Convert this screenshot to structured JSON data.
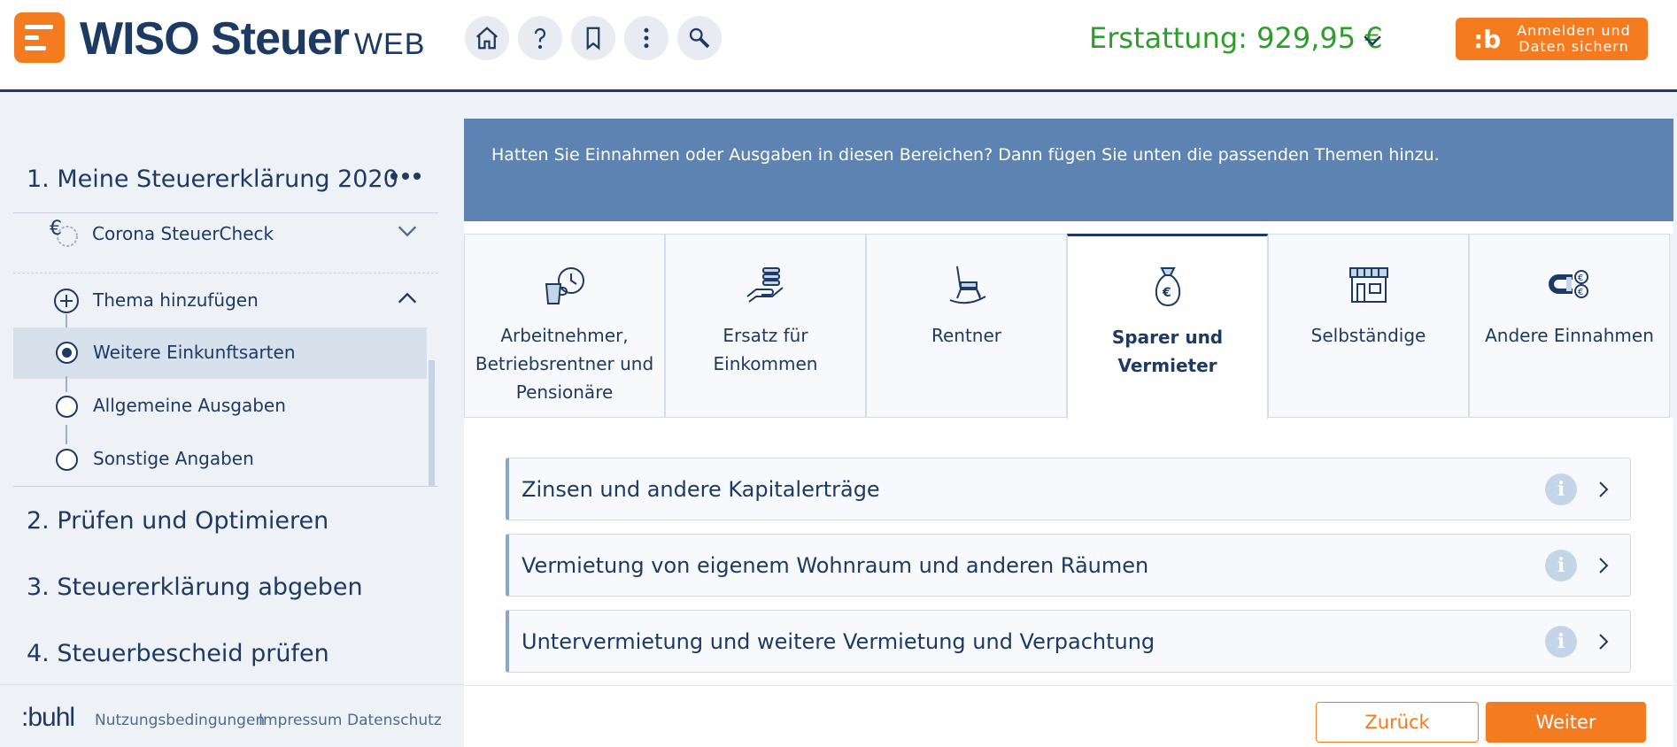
{
  "header": {
    "brand": "WISO Steuer",
    "brand_suffix": "WEB",
    "icons": [
      "home-icon",
      "help-icon",
      "bookmark-icon",
      "more-vertical-icon",
      "search-icon"
    ],
    "refund_label": "Erstattung: 929,95 €",
    "login_glyph": ":b",
    "login_line1": "Anmelden und",
    "login_line2": "Daten sichern"
  },
  "sidebar": {
    "step1": "1. Meine Steuererklärung 2020",
    "corona": "Corona SteuerCheck",
    "thema": "Thema hinzufügen",
    "sub_items": [
      {
        "label": "Weitere Einkunftsarten",
        "checked": true
      },
      {
        "label": "Allgemeine Ausgaben",
        "checked": false
      },
      {
        "label": "Sonstige Angaben",
        "checked": false
      }
    ],
    "step2": "2. Prüfen und Optimieren",
    "step3": "3. Steuererklärung abgeben",
    "step4": "4. Steuerbescheid prüfen"
  },
  "footer": {
    "logo": ":buhl",
    "links": [
      "Nutzungsbedingungen",
      "Impressum",
      "Datenschutz"
    ]
  },
  "main": {
    "banner": "Hatten Sie Einnahmen oder Ausgaben in diesen Bereichen? Dann fügen Sie unten die passenden Themen hinzu.",
    "tabs": [
      {
        "label": "Arbeitnehmer, Betriebsrentner und Pensionäre",
        "icon": "coffee-clock-icon"
      },
      {
        "label": "Ersatz für Einkommen",
        "icon": "hand-money-icon"
      },
      {
        "label": "Rentner",
        "icon": "rocking-chair-icon"
      },
      {
        "label": "Sparer und Vermieter",
        "icon": "money-bag-icon",
        "active": true
      },
      {
        "label": "Selbständige",
        "icon": "shop-icon"
      },
      {
        "label": "Andere Einnahmen",
        "icon": "magnet-coins-icon"
      }
    ],
    "rows": [
      "Zinsen und andere Kapitalerträge",
      "Vermietung von eigenem Wohnraum und anderen Räumen",
      "Untervermietung und weitere Vermietung und Verpachtung"
    ],
    "info_glyph": "i",
    "back_label": "Zurück",
    "next_label": "Weiter"
  },
  "colors": {
    "primary": "#1d3a63",
    "accent": "#f47b20",
    "banner": "#5d83b3",
    "refund": "#2e9d2c"
  }
}
